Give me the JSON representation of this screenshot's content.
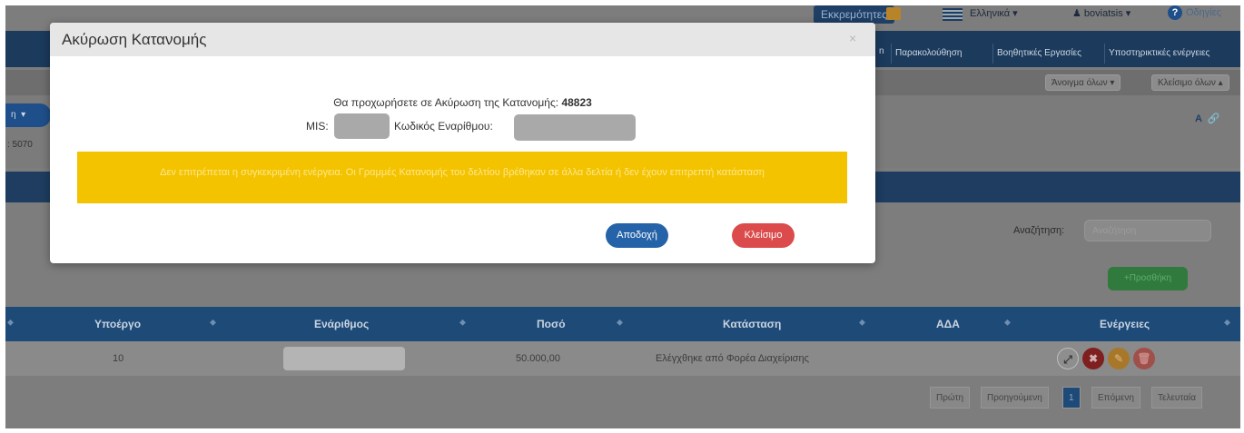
{
  "topbar": {
    "ex_button": "Εκκρεμότητες",
    "language": "Ελληνικά ▾",
    "user": "boviatsis ▾",
    "help": "Οδηγίες"
  },
  "nav": {
    "items": [
      "Παρακολούθηση",
      "Βοηθητικές Εργασίες",
      "Υποστηρικτικές ενέργειες"
    ]
  },
  "toolbar": {
    "open_all": "Άνοιγμα όλων",
    "close_all": "Κλείσιμο όλων"
  },
  "side_text": ": 5070",
  "search": {
    "label": "Αναζήτηση:",
    "placeholder": "Αναζήτηση"
  },
  "add_button": "+Προσθήκη",
  "table": {
    "headers": [
      "Υποέργο",
      "Ενάριθμος",
      "Ποσό",
      "Κατάσταση",
      "ΑΔΑ",
      "Ενέργειες"
    ],
    "row": {
      "subproject": "10",
      "amount": "50.000,00",
      "status": "Ελέγχθηκε από Φορέα Διαχείρισης"
    }
  },
  "pagination": [
    "Πρώτη",
    "Προηγούμενη",
    "1",
    "Επόμενη",
    "Τελευταία"
  ],
  "modal": {
    "title": "Ακύρωση Κατανομής",
    "close_symbol": "×",
    "message_prefix": "Θα προχωρήσετε σε Ακύρωση της Κατανομής:",
    "allocation_id": "48823",
    "mis_label": "MIS:",
    "code_label": "Κωδικός Εναρίθμου:",
    "warning": "Δεν επιτρέπεται η συγκεκριμένη ενέργεια. Οι Γραμμές Κατανομής του δελτίου βρέθηκαν σε άλλα δελτία ή δεν έχουν επιτρεπτή κατάσταση",
    "accept_label": "Αποδοχή",
    "close_label": "Κλείσιμο"
  }
}
